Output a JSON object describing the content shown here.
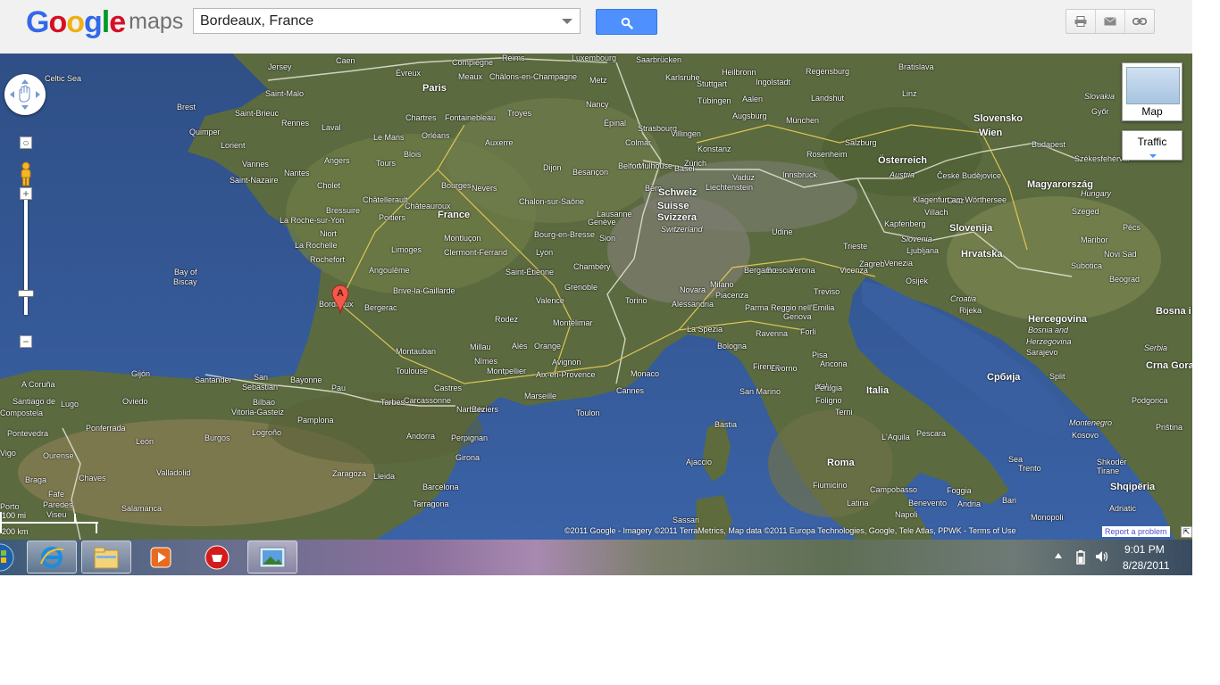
{
  "header": {
    "logo_parts": [
      "G",
      "o",
      "o",
      "g",
      "l",
      "e"
    ],
    "logo_colors": [
      "#3369e8",
      "#d50f25",
      "#eeb211",
      "#3369e8",
      "#009925",
      "#d50f25"
    ],
    "logo_suffix": "maps",
    "search_value": "Bordeaux, France",
    "search_button_icon": "magnifier-icon",
    "tools": [
      {
        "icon": "printer-icon"
      },
      {
        "icon": "envelope-icon"
      },
      {
        "icon": "link-icon"
      }
    ]
  },
  "map": {
    "marker_label": "A",
    "map_type_label": "Map",
    "traffic_label": "Traffic",
    "scale_miles": "100 mi",
    "scale_km": "200 km",
    "copyright": "©2011 Google - Imagery ©2011 TerraMetrics, Map data ©2011 Europa Technologies, Google, Tele Atlas, PPWK - Terms of Use",
    "report_problem": "Report a problem",
    "places": [
      {
        "t": "Celtic Sea",
        "k": "sea"
      },
      {
        "t": "Jersey",
        "k": ""
      },
      {
        "t": "Saint-Malo",
        "k": ""
      },
      {
        "t": "Caen",
        "k": ""
      },
      {
        "t": "Brest",
        "k": ""
      },
      {
        "t": "Saint-Brieuc",
        "k": ""
      },
      {
        "t": "Rennes",
        "k": ""
      },
      {
        "t": "Laval",
        "k": ""
      },
      {
        "t": "Le Mans",
        "k": ""
      },
      {
        "t": "Quimper",
        "k": ""
      },
      {
        "t": "Lorient",
        "k": ""
      },
      {
        "t": "Vannes",
        "k": ""
      },
      {
        "t": "Angers",
        "k": ""
      },
      {
        "t": "Tours",
        "k": ""
      },
      {
        "t": "Saint-Nazaire",
        "k": ""
      },
      {
        "t": "Nantes",
        "k": ""
      },
      {
        "t": "Cholet",
        "k": ""
      },
      {
        "t": "Blois",
        "k": ""
      },
      {
        "t": "Châteauroux",
        "k": ""
      },
      {
        "t": "Châtellerault",
        "k": ""
      },
      {
        "t": "Bressuire",
        "k": ""
      },
      {
        "t": "Poitiers",
        "k": ""
      },
      {
        "t": "La Roche-sur-Yon",
        "k": ""
      },
      {
        "t": "Niort",
        "k": ""
      },
      {
        "t": "La Rochelle",
        "k": ""
      },
      {
        "t": "Rochefort",
        "k": ""
      },
      {
        "t": "Angoulême",
        "k": ""
      },
      {
        "t": "Limoges",
        "k": ""
      },
      {
        "t": "Bay of",
        "k": "sea"
      },
      {
        "t": "Biscay",
        "k": "sea"
      },
      {
        "t": "Brive-la-Gaillarde",
        "k": ""
      },
      {
        "t": "Bordeaux",
        "k": ""
      },
      {
        "t": "Bergerac",
        "k": ""
      },
      {
        "t": "Paris",
        "k": "big"
      },
      {
        "t": "Chartres",
        "k": ""
      },
      {
        "t": "Fontainebleau",
        "k": ""
      },
      {
        "t": "Orléans",
        "k": ""
      },
      {
        "t": "Bourges",
        "k": ""
      },
      {
        "t": "Nevers",
        "k": ""
      },
      {
        "t": "France",
        "k": "big"
      },
      {
        "t": "Montluçon",
        "k": ""
      },
      {
        "t": "Clermont-Ferrand",
        "k": ""
      },
      {
        "t": "Lyon",
        "k": ""
      },
      {
        "t": "Saint-Étienne",
        "k": ""
      },
      {
        "t": "Dijon",
        "k": ""
      },
      {
        "t": "Besançon",
        "k": ""
      },
      {
        "t": "Chalon-sur-Saône",
        "k": ""
      },
      {
        "t": "Bourg-en-Bresse",
        "k": ""
      },
      {
        "t": "Chambéry",
        "k": ""
      },
      {
        "t": "Grenoble",
        "k": ""
      },
      {
        "t": "Valence",
        "k": ""
      },
      {
        "t": "Montélimar",
        "k": ""
      },
      {
        "t": "Avignon",
        "k": ""
      },
      {
        "t": "Orange",
        "k": ""
      },
      {
        "t": "Alès",
        "k": ""
      },
      {
        "t": "Nîmes",
        "k": ""
      },
      {
        "t": "Montpellier",
        "k": ""
      },
      {
        "t": "Aix-en-Provence",
        "k": ""
      },
      {
        "t": "Marseille",
        "k": ""
      },
      {
        "t": "Toulon",
        "k": ""
      },
      {
        "t": "Cannes",
        "k": ""
      },
      {
        "t": "Monaco",
        "k": ""
      },
      {
        "t": "Toulouse",
        "k": ""
      },
      {
        "t": "Montauban",
        "k": ""
      },
      {
        "t": "Castres",
        "k": ""
      },
      {
        "t": "Carcassonne",
        "k": ""
      },
      {
        "t": "Narbonne",
        "k": ""
      },
      {
        "t": "Béziers",
        "k": ""
      },
      {
        "t": "Perpignan",
        "k": ""
      },
      {
        "t": "Andorra",
        "k": ""
      },
      {
        "t": "Bayonne",
        "k": ""
      },
      {
        "t": "Pau",
        "k": ""
      },
      {
        "t": "Tarbes",
        "k": ""
      },
      {
        "t": "Millau",
        "k": ""
      },
      {
        "t": "Rodez",
        "k": ""
      },
      {
        "t": "Reims",
        "k": ""
      },
      {
        "t": "Compiègne",
        "k": ""
      },
      {
        "t": "Meaux",
        "k": ""
      },
      {
        "t": "Châlons-en-Champagne",
        "k": ""
      },
      {
        "t": "Troyes",
        "k": ""
      },
      {
        "t": "Auxerre",
        "k": ""
      },
      {
        "t": "Évreux",
        "k": ""
      },
      {
        "t": "Luxembourg",
        "k": ""
      },
      {
        "t": "Metz",
        "k": ""
      },
      {
        "t": "Nancy",
        "k": ""
      },
      {
        "t": "Épinal",
        "k": ""
      },
      {
        "t": "Strasbourg",
        "k": ""
      },
      {
        "t": "Colmar",
        "k": ""
      },
      {
        "t": "Mulhouse",
        "k": ""
      },
      {
        "t": "Belfort",
        "k": ""
      },
      {
        "t": "Basel",
        "k": ""
      },
      {
        "t": "Zürich",
        "k": ""
      },
      {
        "t": "Bern",
        "k": ""
      },
      {
        "t": "Schweiz",
        "k": "big"
      },
      {
        "t": "Suisse",
        "k": "big"
      },
      {
        "t": "Svizzera",
        "k": "big"
      },
      {
        "t": "Switzerland",
        "k": "it"
      },
      {
        "t": "Lausanne",
        "k": ""
      },
      {
        "t": "Genève",
        "k": ""
      },
      {
        "t": "Sion",
        "k": ""
      },
      {
        "t": "Saarbrücken",
        "k": ""
      },
      {
        "t": "Karlsruhe",
        "k": ""
      },
      {
        "t": "Stuttgart",
        "k": ""
      },
      {
        "t": "Heilbronn",
        "k": ""
      },
      {
        "t": "Tübingen",
        "k": ""
      },
      {
        "t": "Aalen",
        "k": ""
      },
      {
        "t": "Augsburg",
        "k": ""
      },
      {
        "t": "Ingolstadt",
        "k": ""
      },
      {
        "t": "Regensburg",
        "k": ""
      },
      {
        "t": "Landshut",
        "k": ""
      },
      {
        "t": "München",
        "k": ""
      },
      {
        "t": "Konstanz",
        "k": ""
      },
      {
        "t": "Villingen",
        "k": ""
      },
      {
        "t": "Vaduz",
        "k": ""
      },
      {
        "t": "Liechtenstein",
        "k": ""
      },
      {
        "t": "Innsbruck",
        "k": ""
      },
      {
        "t": "Rosenheim",
        "k": ""
      },
      {
        "t": "Salzburg",
        "k": ""
      },
      {
        "t": "Linz",
        "k": ""
      },
      {
        "t": "Wien",
        "k": "big"
      },
      {
        "t": "Österreich",
        "k": "big"
      },
      {
        "t": "Austria",
        "k": "it"
      },
      {
        "t": "Graz",
        "k": ""
      },
      {
        "t": "Klagenfurt am Wörthersee",
        "k": ""
      },
      {
        "t": "Villach",
        "k": ""
      },
      {
        "t": "Kapfenberg",
        "k": ""
      },
      {
        "t": "České Budějovice",
        "k": ""
      },
      {
        "t": "Bratislava",
        "k": ""
      },
      {
        "t": "Slovensko",
        "k": "big"
      },
      {
        "t": "Slovakia",
        "k": "it"
      },
      {
        "t": "Győr",
        "k": ""
      },
      {
        "t": "Budapest",
        "k": ""
      },
      {
        "t": "Székesfehérvár",
        "k": ""
      },
      {
        "t": "Magyarország",
        "k": "big"
      },
      {
        "t": "Hungary",
        "k": "it"
      },
      {
        "t": "Szeged",
        "k": ""
      },
      {
        "t": "Pécs",
        "k": ""
      },
      {
        "t": "Maribor",
        "k": ""
      },
      {
        "t": "Slovenija",
        "k": "big"
      },
      {
        "t": "Slovenia",
        "k": "it"
      },
      {
        "t": "Ljubljana",
        "k": ""
      },
      {
        "t": "Zagreb",
        "k": ""
      },
      {
        "t": "Hrvatska",
        "k": "big"
      },
      {
        "t": "Croatia",
        "k": "it"
      },
      {
        "t": "Rijeka",
        "k": ""
      },
      {
        "t": "Osijek",
        "k": ""
      },
      {
        "t": "Subotica",
        "k": ""
      },
      {
        "t": "Novi Sad",
        "k": ""
      },
      {
        "t": "Beograd",
        "k": ""
      },
      {
        "t": "Bosna i",
        "k": "big"
      },
      {
        "t": "Hercegovina",
        "k": "big"
      },
      {
        "t": "Bosnia and",
        "k": "it"
      },
      {
        "t": "Herzegovina",
        "k": "it"
      },
      {
        "t": "Sarajevo",
        "k": ""
      },
      {
        "t": "Split",
        "k": ""
      },
      {
        "t": "Србија",
        "k": "big"
      },
      {
        "t": "Serbia",
        "k": "it"
      },
      {
        "t": "Crna Gora",
        "k": "big"
      },
      {
        "t": "Montenegro",
        "k": "it"
      },
      {
        "t": "Kosovo",
        "k": ""
      },
      {
        "t": "Priština",
        "k": ""
      },
      {
        "t": "Podgorica",
        "k": ""
      },
      {
        "t": "Shkodër",
        "k": ""
      },
      {
        "t": "Tirane",
        "k": ""
      },
      {
        "t": "Shqipëria",
        "k": "big"
      },
      {
        "t": "Adriatic",
        "k": "sea"
      },
      {
        "t": "Sea",
        "k": "sea"
      },
      {
        "t": "Trento",
        "k": ""
      },
      {
        "t": "Udine",
        "k": ""
      },
      {
        "t": "Trieste",
        "k": ""
      },
      {
        "t": "Venezia",
        "k": ""
      },
      {
        "t": "Treviso",
        "k": ""
      },
      {
        "t": "Vicenza",
        "k": ""
      },
      {
        "t": "Verona",
        "k": ""
      },
      {
        "t": "Brescia",
        "k": ""
      },
      {
        "t": "Bergamo",
        "k": ""
      },
      {
        "t": "Milano",
        "k": ""
      },
      {
        "t": "Novara",
        "k": ""
      },
      {
        "t": "Torino",
        "k": ""
      },
      {
        "t": "Piacenza",
        "k": ""
      },
      {
        "t": "Alessandria",
        "k": ""
      },
      {
        "t": "Parma",
        "k": ""
      },
      {
        "t": "Reggio nell'Emilia",
        "k": ""
      },
      {
        "t": "Genova",
        "k": ""
      },
      {
        "t": "La Spezia",
        "k": ""
      },
      {
        "t": "Bologna",
        "k": ""
      },
      {
        "t": "Ravenna",
        "k": ""
      },
      {
        "t": "Forlì",
        "k": ""
      },
      {
        "t": "Pisa",
        "k": ""
      },
      {
        "t": "Firenze",
        "k": ""
      },
      {
        "t": "Livorno",
        "k": ""
      },
      {
        "t": "San Marino",
        "k": ""
      },
      {
        "t": "Ancona",
        "k": ""
      },
      {
        "t": "Italia",
        "k": "big"
      },
      {
        "t": "Italy",
        "k": "it"
      },
      {
        "t": "Perugia",
        "k": ""
      },
      {
        "t": "Foligno",
        "k": ""
      },
      {
        "t": "Terni",
        "k": ""
      },
      {
        "t": "L'Aquila",
        "k": ""
      },
      {
        "t": "Pescara",
        "k": ""
      },
      {
        "t": "Roma",
        "k": "big"
      },
      {
        "t": "Latina",
        "k": ""
      },
      {
        "t": "Fiumicino",
        "k": ""
      },
      {
        "t": "Campobasso",
        "k": ""
      },
      {
        "t": "Foggia",
        "k": ""
      },
      {
        "t": "Benevento",
        "k": ""
      },
      {
        "t": "Andria",
        "k": ""
      },
      {
        "t": "Bari",
        "k": ""
      },
      {
        "t": "Napoli",
        "k": ""
      },
      {
        "t": "Monopoli",
        "k": ""
      },
      {
        "t": "Bastia",
        "k": ""
      },
      {
        "t": "Ajaccio",
        "k": ""
      },
      {
        "t": "Sassari",
        "k": ""
      },
      {
        "t": "Gijón",
        "k": ""
      },
      {
        "t": "Oviedo",
        "k": ""
      },
      {
        "t": "Santander",
        "k": ""
      },
      {
        "t": "San",
        "k": ""
      },
      {
        "t": "Sebastián",
        "k": ""
      },
      {
        "t": "Bilbao",
        "k": ""
      },
      {
        "t": "Vitoria-Gasteiz",
        "k": ""
      },
      {
        "t": "Pamplona",
        "k": ""
      },
      {
        "t": "Logroño",
        "k": ""
      },
      {
        "t": "Burgos",
        "k": ""
      },
      {
        "t": "A Coruña",
        "k": ""
      },
      {
        "t": "Lugo",
        "k": ""
      },
      {
        "t": "Santiago de",
        "k": ""
      },
      {
        "t": "Compostela",
        "k": ""
      },
      {
        "t": "Ponferrada",
        "k": ""
      },
      {
        "t": "León",
        "k": ""
      },
      {
        "t": "Pontevedra",
        "k": ""
      },
      {
        "t": "Vigo",
        "k": ""
      },
      {
        "t": "Ourense",
        "k": ""
      },
      {
        "t": "Valladolid",
        "k": ""
      },
      {
        "t": "Zaragoza",
        "k": ""
      },
      {
        "t": "Lleida",
        "k": ""
      },
      {
        "t": "Barcelona",
        "k": ""
      },
      {
        "t": "Girona",
        "k": ""
      },
      {
        "t": "Tarragona",
        "k": ""
      },
      {
        "t": "Braga",
        "k": ""
      },
      {
        "t": "Chaves",
        "k": ""
      },
      {
        "t": "Porto",
        "k": ""
      },
      {
        "t": "Viseu",
        "k": ""
      },
      {
        "t": "Fafe",
        "k": ""
      },
      {
        "t": "Salamanca",
        "k": ""
      },
      {
        "t": "Paredes",
        "k": ""
      }
    ]
  },
  "taskbar": {
    "apps": [
      {
        "icon": "start-orb-icon",
        "active": false
      },
      {
        "icon": "internet-explorer-icon",
        "active": true
      },
      {
        "icon": "file-explorer-icon",
        "active": true
      },
      {
        "icon": "media-player-icon",
        "active": false
      },
      {
        "icon": "record-app-icon",
        "active": false
      },
      {
        "icon": "picture-viewer-icon",
        "active": true
      }
    ],
    "clock_time": "9:01 PM",
    "clock_date": "8/28/2011"
  }
}
